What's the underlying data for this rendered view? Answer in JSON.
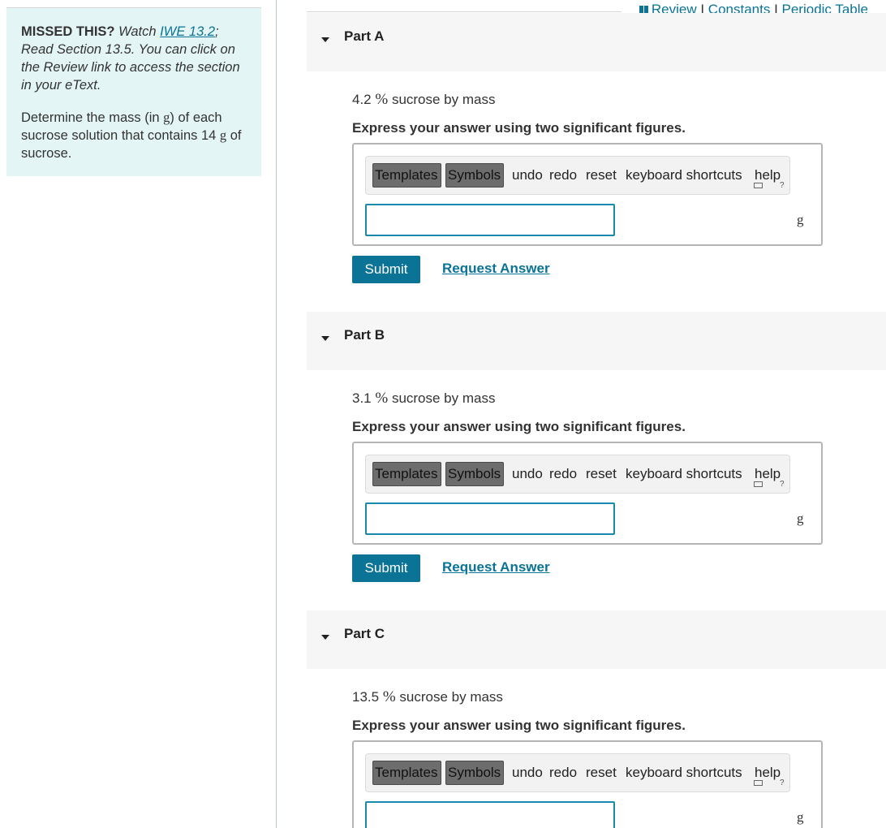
{
  "sidebar": {
    "missed_label": "MISSED THIS?",
    "watch_text": "Watch",
    "iwe_link": "IWE 13.2",
    "semicolon": ";",
    "read_text": "Read Section 13.5. You can click on the Review link to access the section in your eText.",
    "prompt_pre": "Determine the mass (in ",
    "prompt_unit": "g",
    "prompt_mid": ") of each sucrose solution that contains 14 ",
    "prompt_unit2": "g",
    "prompt_post": " of sucrose."
  },
  "top_links": {
    "review": "Review",
    "separator": " I ",
    "constants": "Constants",
    "periodic_table": "Periodic Table"
  },
  "toolbar": {
    "templates": "Templates",
    "symbols": "Symbols",
    "undo": "undo",
    "redo": "redo",
    "reset": "reset",
    "keyboard_shortcuts": "keyboard shortcuts",
    "help": "help",
    "help_mark": "?"
  },
  "parts": [
    {
      "title": "Part A",
      "value": "4.2",
      "percent_sign": "%",
      "rest": "sucrose by mass",
      "instruction": "Express your answer using two significant figures.",
      "input_value": "",
      "unit": "g",
      "submit": "Submit",
      "request": "Request Answer"
    },
    {
      "title": "Part B",
      "value": "3.1",
      "percent_sign": "%",
      "rest": "sucrose by mass",
      "instruction": "Express your answer using two significant figures.",
      "input_value": "",
      "unit": "g",
      "submit": "Submit",
      "request": "Request Answer"
    },
    {
      "title": "Part C",
      "value": "13.5",
      "percent_sign": "%",
      "rest": "sucrose by mass",
      "instruction": "Express your answer using two significant figures.",
      "input_value": "",
      "unit": "g"
    }
  ],
  "colors": {
    "link": "#0a7396",
    "sidebar_bg": "#e4f5f5",
    "input_border": "#1a87ad",
    "submit_bg": "#0a7396"
  }
}
